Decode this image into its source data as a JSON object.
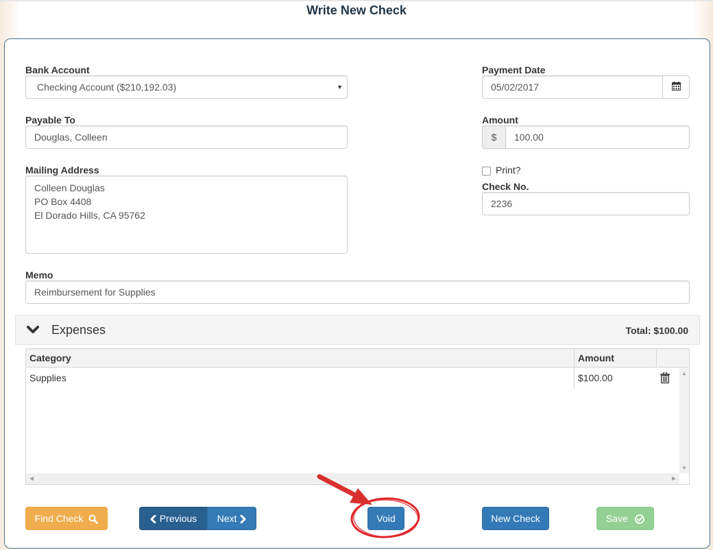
{
  "page": {
    "title": "Write New Check"
  },
  "form": {
    "bank_account": {
      "label": "Bank Account",
      "value": "Checking Account ($210,192.03)"
    },
    "payable_to": {
      "label": "Payable To",
      "value": "Douglas, Colleen"
    },
    "mailing_address": {
      "label": "Mailing Address",
      "lines": [
        "Colleen Douglas",
        "PO Box 4408",
        "El Dorado Hills, CA 95762"
      ]
    },
    "memo": {
      "label": "Memo",
      "value": "Reimbursement for Supplies"
    },
    "payment_date": {
      "label": "Payment Date",
      "value": "05/02/2017"
    },
    "amount": {
      "label": "Amount",
      "currency_symbol": "$",
      "value": "100.00"
    },
    "print": {
      "label": "Print?",
      "checked": false
    },
    "check_no": {
      "label": "Check No.",
      "value": "2236"
    }
  },
  "expenses": {
    "title": "Expenses",
    "total_label": "Total: $100.00",
    "columns": [
      "Category",
      "Amount"
    ],
    "rows": [
      {
        "category": "Supplies",
        "amount": "$100.00"
      }
    ]
  },
  "buttons": {
    "find_check": "Find Check",
    "previous": "Previous",
    "next": "Next",
    "void": "Void",
    "new_check": "New Check",
    "save": "Save"
  },
  "colors": {
    "warning": "#f0ad4e",
    "primary": "#337ab7",
    "primary_dark": "#286090",
    "success": "#5cb85c",
    "annotation": "#e0262a"
  }
}
